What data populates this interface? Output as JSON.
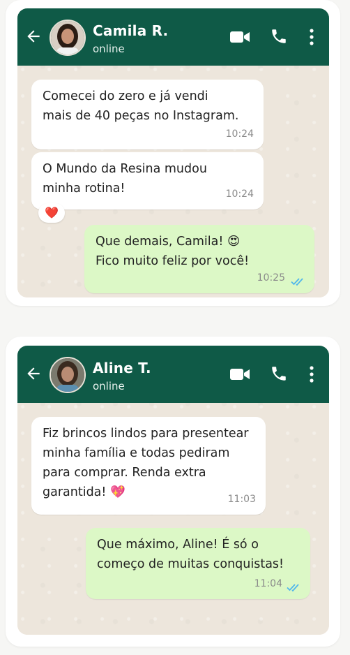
{
  "chats": [
    {
      "contact_name": "Camila R.",
      "status": "online",
      "messages": [
        {
          "direction": "in",
          "text": "Comecei do zero e já vendi\nmais de 40 peças no Instagram.",
          "time": "10:24"
        },
        {
          "direction": "in",
          "text": "O Mundo da Resina mudou\nminha rotina!",
          "time": "10:24",
          "reaction": "❤️"
        },
        {
          "direction": "out",
          "text": "Que demais, Camila! 😍\nFico muito feliz por você!",
          "time": "10:25",
          "read": true
        }
      ]
    },
    {
      "contact_name": "Aline T.",
      "status": "online",
      "messages": [
        {
          "direction": "in",
          "text": "Fiz brincos lindos para presentear\nminha família e todas pediram\npara comprar. Renda extra\ngarantida! 💖",
          "time": "11:03"
        },
        {
          "direction": "out",
          "text": "Que máximo, Aline! É só o\ncomeço de muitas conquistas!",
          "time": "11:04",
          "read": true
        }
      ]
    }
  ],
  "colors": {
    "header": "#0f5a47",
    "incoming_bubble": "#ffffff",
    "outgoing_bubble": "#dcf8c6",
    "read_ticks": "#4fb6ec",
    "wallpaper": "#ede6dc"
  },
  "icons": [
    "back-arrow-icon",
    "video-call-icon",
    "phone-icon",
    "more-options-icon",
    "double-check-icon"
  ]
}
